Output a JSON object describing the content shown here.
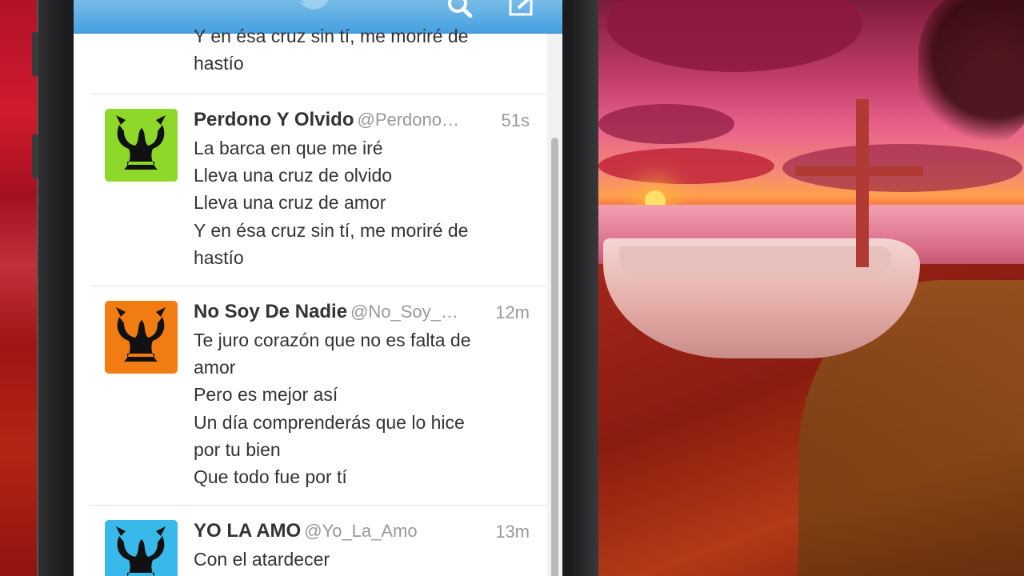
{
  "app": {
    "brand_color": "#55acee",
    "nav_icons": [
      "twitter-bird-icon",
      "search-icon",
      "compose-icon"
    ]
  },
  "timeline": {
    "partial_tweet": {
      "lines": [
        "Y en ésa cruz sin tí, me moriré de",
        "hastío"
      ]
    },
    "tweets": [
      {
        "name": "Perdono Y Olvido",
        "handle": "@Perdono…",
        "time": "51s",
        "avatar_color": "#8ed82a",
        "lines": [
          "La barca en que me iré",
          "Lleva una cruz de olvido",
          "Lleva una cruz de amor",
          "Y en ésa cruz sin tí, me moriré de",
          "hastío"
        ]
      },
      {
        "name": "No Soy De Nadie",
        "handle": "@No_Soy_…",
        "time": "12m",
        "avatar_color": "#f07c12",
        "lines": [
          "Te juro corazón que no es falta de",
          "amor",
          "Pero es mejor así",
          "Un día comprenderás que lo hice",
          "por tu bien",
          "Que todo fue por tí"
        ]
      },
      {
        "name": "YO LA AMO",
        "handle": "@Yo_La_Amo",
        "time": "13m",
        "avatar_color": "#39b8ea",
        "lines": [
          "Con el atardecer"
        ]
      }
    ]
  }
}
